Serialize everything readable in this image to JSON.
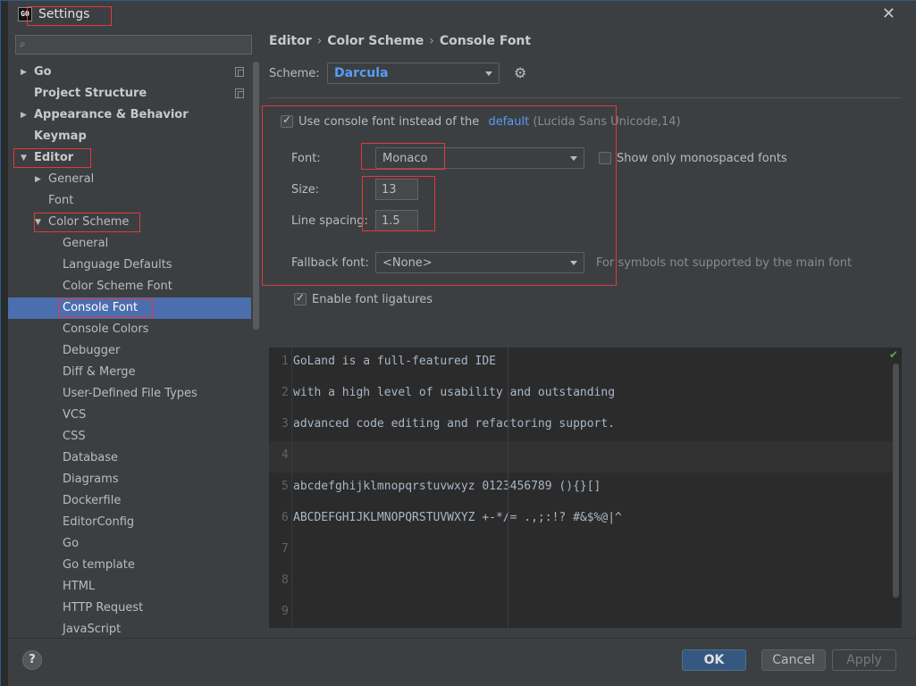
{
  "window": {
    "title": "Settings",
    "app_icon": "GO"
  },
  "search": {
    "placeholder": "",
    "value": ""
  },
  "tree": [
    {
      "label": "Go",
      "level": 0,
      "bold": true,
      "expandable": true,
      "expanded": false,
      "copy_icon": true
    },
    {
      "label": "Project Structure",
      "level": 0,
      "bold": true,
      "expandable": false,
      "copy_icon": true
    },
    {
      "label": "Appearance & Behavior",
      "level": 0,
      "bold": true,
      "expandable": true,
      "expanded": false
    },
    {
      "label": "Keymap",
      "level": 0,
      "bold": true,
      "expandable": false
    },
    {
      "label": "Editor",
      "level": 0,
      "bold": true,
      "expandable": true,
      "expanded": true
    },
    {
      "label": "General",
      "level": 1,
      "expandable": true,
      "expanded": false
    },
    {
      "label": "Font",
      "level": 1,
      "expandable": false
    },
    {
      "label": "Color Scheme",
      "level": 1,
      "expandable": true,
      "expanded": true
    },
    {
      "label": "General",
      "level": 2
    },
    {
      "label": "Language Defaults",
      "level": 2
    },
    {
      "label": "Color Scheme Font",
      "level": 2
    },
    {
      "label": "Console Font",
      "level": 2,
      "selected": true
    },
    {
      "label": "Console Colors",
      "level": 2
    },
    {
      "label": "Debugger",
      "level": 2
    },
    {
      "label": "Diff & Merge",
      "level": 2
    },
    {
      "label": "User-Defined File Types",
      "level": 2
    },
    {
      "label": "VCS",
      "level": 2
    },
    {
      "label": "CSS",
      "level": 2
    },
    {
      "label": "Database",
      "level": 2
    },
    {
      "label": "Diagrams",
      "level": 2
    },
    {
      "label": "Dockerfile",
      "level": 2
    },
    {
      "label": "EditorConfig",
      "level": 2
    },
    {
      "label": "Go",
      "level": 2
    },
    {
      "label": "Go template",
      "level": 2
    },
    {
      "label": "HTML",
      "level": 2
    },
    {
      "label": "HTTP Request",
      "level": 2
    },
    {
      "label": "JavaScript",
      "level": 2
    }
  ],
  "breadcrumb": [
    "Editor",
    "Color Scheme",
    "Console Font"
  ],
  "scheme": {
    "label": "Scheme:",
    "value": "Darcula"
  },
  "console_font": {
    "use_console_font_label": "Use console font instead of the",
    "default_link": "default",
    "default_info": "(Lucida Sans Unicode,14)",
    "use_console_font_checked": true,
    "font_label": "Font:",
    "font_value": "Monaco",
    "show_monospaced_label": "Show only monospaced fonts",
    "show_monospaced_checked": false,
    "size_label": "Size:",
    "size_value": "13",
    "line_spacing_label": "Line spacing:",
    "line_spacing_value": "1.5",
    "fallback_label": "Fallback font:",
    "fallback_value": "<None>",
    "fallback_hint": "For symbols not supported by the main font",
    "ligatures_label": "Enable font ligatures",
    "ligatures_checked": true
  },
  "preview": {
    "lines": [
      {
        "num": "1",
        "text": "GoLand is a full-featured IDE"
      },
      {
        "num": "2",
        "text": "with a high level of usability and outstanding"
      },
      {
        "num": "3",
        "text": "advanced code editing and refactoring support."
      },
      {
        "num": "4",
        "text": "",
        "current": true
      },
      {
        "num": "5",
        "text": "abcdefghijklmnopqrstuvwxyz 0123456789 (){}[]"
      },
      {
        "num": "6",
        "text": "ABCDEFGHIJKLMNOPQRSTUVWXYZ +-*/= .,;:!? #&$%@|^"
      },
      {
        "num": "7",
        "text": ""
      },
      {
        "num": "8",
        "text": ""
      },
      {
        "num": "9",
        "text": ""
      }
    ]
  },
  "buttons": {
    "help": "?",
    "ok": "OK",
    "cancel": "Cancel",
    "apply": "Apply"
  },
  "icons": {
    "close": "close-icon",
    "search": "search-icon",
    "gear": "gear-icon",
    "help": "help-icon",
    "check": "checkmark-icon"
  }
}
